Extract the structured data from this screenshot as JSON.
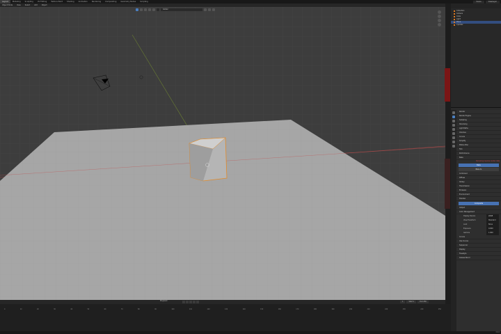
{
  "workspace_tabs": [
    "Layout",
    "Modeling",
    "Sculpting",
    "UV Editing",
    "Texture Paint",
    "Shading",
    "Animation",
    "Rendering",
    "Compositing",
    "Geometry Nodes",
    "Scripting"
  ],
  "active_tab_index": 0,
  "topbar_right": [
    "Scene",
    "ViewLayer"
  ],
  "viewport_header": {
    "items": [
      "Object Mode",
      "View",
      "Select",
      "Add",
      "Object"
    ],
    "orientation": "Global",
    "snap_label": "Individual"
  },
  "outliner": {
    "rows": [
      {
        "label": "Collection",
        "selected": false
      },
      {
        "label": "Camera",
        "selected": false
      },
      {
        "label": "Cube",
        "selected": false
      },
      {
        "label": "Light",
        "selected": false
      },
      {
        "label": "Plane",
        "selected": true
      },
      {
        "label": "Cylinder",
        "selected": false
      }
    ]
  },
  "properties": {
    "header": "Render",
    "engine_label": "Render Engine",
    "sections": [
      "Sampling",
      "Denoising",
      "Light Paths",
      "Volumes",
      "Curves",
      "Simplify",
      "Motion Blur",
      "Film",
      "Performance",
      "Bake"
    ],
    "bake_button": "Bake",
    "bake_to_label": "Bake to",
    "warning": "Denoising requires render data",
    "passes": [
      "Combined",
      "Diffuse",
      "Glossy",
      "Transmission",
      "Emission",
      "Environment",
      "Shadow"
    ],
    "output_header": "Output",
    "compositing_button": "Composite",
    "color_management": {
      "header": "Color Management",
      "display_device_label": "Display Device",
      "display_device": "sRGB",
      "view_transform_label": "View Transform",
      "view_transform": "Standard",
      "look_label": "Look",
      "look": "None",
      "exposure_label": "Exposure",
      "exposure": "0.000",
      "gamma_label": "Gamma",
      "gamma": "1.000"
    },
    "extra_rows": [
      "Curves",
      "Use Curves",
      "Sequencer",
      "Display",
      "Freestyle",
      "Grease Pencil"
    ]
  },
  "timeline": {
    "label": "Playback",
    "start": "Start 1",
    "end": "End 250",
    "current": "1",
    "ruler": [
      "0",
      "10",
      "20",
      "30",
      "40",
      "50",
      "60",
      "70",
      "80",
      "90",
      "100",
      "110",
      "120",
      "130",
      "140",
      "150",
      "160",
      "170",
      "180",
      "190",
      "200",
      "210",
      "220",
      "230",
      "240",
      "250"
    ]
  },
  "status_text": "3.6.0",
  "colors": {
    "viewport_bg": "#3d3d3d",
    "plane": "#a6a6a6",
    "cube_outline": "#e08a2a",
    "axis_x": "#b44a4a",
    "axis_y": "#7d9a2f",
    "accent_blue": "#4772b3"
  }
}
